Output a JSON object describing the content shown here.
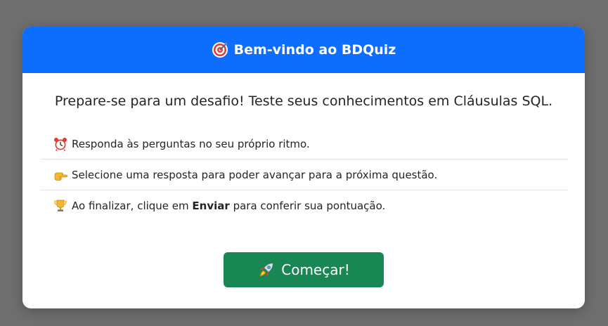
{
  "modal": {
    "title": "Bem-vindo ao BDQuiz",
    "title_icon": "target-icon",
    "intro": "Prepare-se para um desafio! Teste seus conhecimentos em Cláusulas SQL.",
    "rules": [
      {
        "icon": "alarm-clock-icon",
        "text": "Responda às perguntas no seu próprio ritmo."
      },
      {
        "icon": "pointing-hand-icon",
        "text": "Selecione uma resposta para poder avançar para a próxima questão."
      },
      {
        "icon": "trophy-icon",
        "text_before": "Ao finalizar, clique em ",
        "text_bold": "Enviar",
        "text_after": " para conferir sua pontuação."
      }
    ],
    "start_button": {
      "icon": "rocket-icon",
      "label": "Começar!"
    }
  },
  "colors": {
    "header": "#0d6efd",
    "button": "#198754",
    "backdrop": "#6f6f6f"
  }
}
